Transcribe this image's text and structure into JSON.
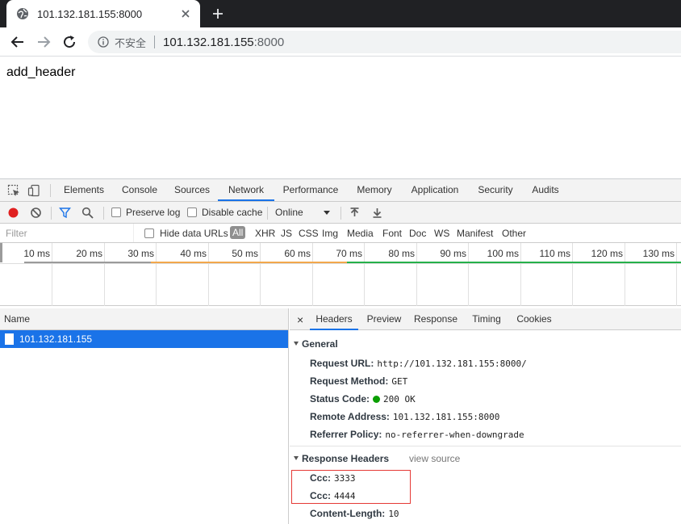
{
  "browser": {
    "tab_title": "101.132.181.155:8000",
    "insecure_label": "不安全",
    "url_host": "101.132.181.155",
    "url_port": ":8000"
  },
  "page": {
    "body_text": "add_header"
  },
  "devtools": {
    "tabs": [
      "Elements",
      "Console",
      "Sources",
      "Network",
      "Performance",
      "Memory",
      "Application",
      "Security",
      "Audits"
    ],
    "active_tab": "Network",
    "network_toolbar": {
      "preserve_log": "Preserve log",
      "disable_cache": "Disable cache",
      "throttling": "Online"
    },
    "filter": {
      "placeholder": "Filter",
      "hide_data_urls": "Hide data URLs",
      "types": [
        "All",
        "XHR",
        "JS",
        "CSS",
        "Img",
        "Media",
        "Font",
        "Doc",
        "WS",
        "Manifest",
        "Other"
      ]
    },
    "timeline": {
      "ticks": [
        "10 ms",
        "20 ms",
        "30 ms",
        "40 ms",
        "50 ms",
        "60 ms",
        "70 ms",
        "80 ms",
        "90 ms",
        "100 ms",
        "110 ms",
        "120 ms",
        "130 ms"
      ],
      "colors": {
        "waiting": "#9b9b9b",
        "stalled": "#f2a74b",
        "download": "#25b04a"
      }
    },
    "request_list": {
      "column_name": "Name",
      "rows": [
        {
          "name": "101.132.181.155"
        }
      ]
    },
    "details": {
      "close": "×",
      "tabs": [
        "Headers",
        "Preview",
        "Response",
        "Timing",
        "Cookies"
      ],
      "active_tab": "Headers",
      "general": {
        "title": "General",
        "request_url_key": "Request URL:",
        "request_url": "http://101.132.181.155:8000/",
        "request_method_key": "Request Method:",
        "request_method": "GET",
        "status_code_key": "Status Code:",
        "status_code": "200 OK",
        "remote_address_key": "Remote Address:",
        "remote_address": "101.132.181.155:8000",
        "referrer_policy_key": "Referrer Policy:",
        "referrer_policy": "no-referrer-when-downgrade"
      },
      "response_headers": {
        "title": "Response Headers",
        "view_source": "view source",
        "h1_key": "Ccc:",
        "h1_val": "3333",
        "h2_key": "Ccc:",
        "h2_val": "4444",
        "h3_key": "Content-Length:",
        "h3_val": "10"
      },
      "highlight_color": "#e53935"
    }
  }
}
